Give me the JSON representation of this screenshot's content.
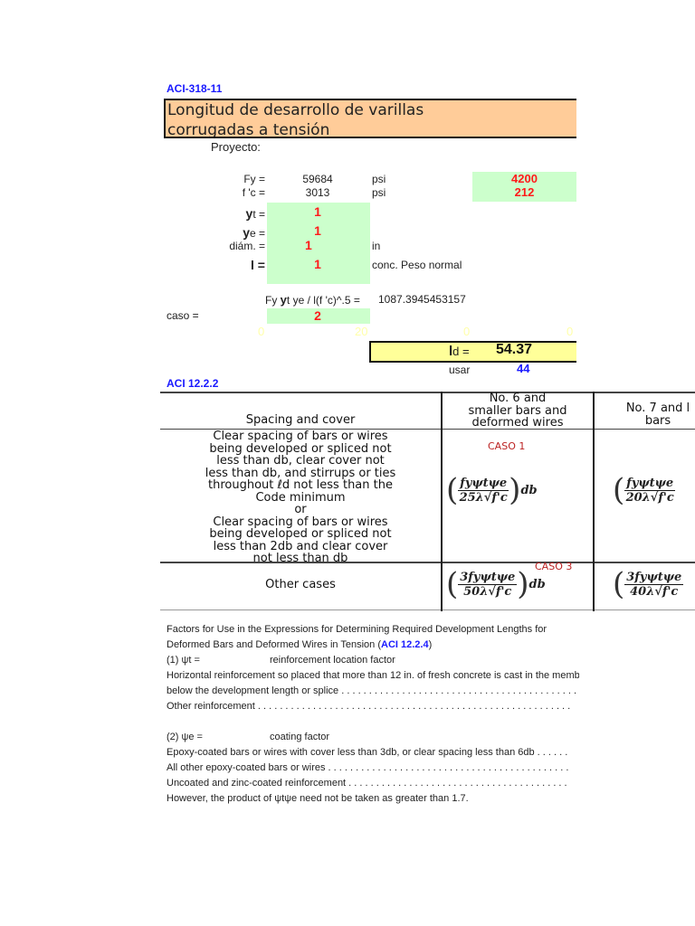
{
  "header": {
    "code": "ACI-318-11",
    "title_line1": "Longitud de desarrollo de varillas",
    "title_line2": "corrugadas a tensión",
    "project_label": "Proyecto:"
  },
  "inputs": {
    "fy": {
      "label": "Fy =",
      "value": "59684",
      "unit": "psi",
      "alt": "4200"
    },
    "fc": {
      "label": "f 'c =",
      "value": "3013",
      "unit": "psi",
      "alt": "212"
    },
    "psit": {
      "label_b": "y",
      "label": "t =",
      "value": "1"
    },
    "psie": {
      "label_b": "y",
      "label": "e =",
      "value": "1"
    },
    "diam": {
      "label": "diám.  =",
      "value": "1",
      "unit": "in"
    },
    "lambda": {
      "label": "l =",
      "value": "1",
      "unit": "conc. Peso normal"
    }
  },
  "calc": {
    "formula_a": "Fy ",
    "formula_b": "y",
    "formula_c": "t ye / l(f 'c)^.5 =",
    "formula_value": "1087.3945453157",
    "caso_label": "caso =",
    "caso_value": "2",
    "hidden": [
      "0",
      "20",
      "0",
      "0"
    ],
    "ld_label_b": "l",
    "ld_label": "d =",
    "ld_value": "54.37",
    "usar_label": "usar",
    "usar_value": "44"
  },
  "table": {
    "ref": "ACI 12.2.2",
    "headers": [
      "Spacing and cover",
      "No. 6 and\nsmaller bars and\ndeformed wires",
      "No. 7 and l\nbars"
    ],
    "row1_text": "Clear spacing of bars or wires\nbeing developed or spliced not\nless than db, clear cover not\nless than db, and stirrups or ties\nthroughout ℓd not less than the\nCode minimum\nor\nClear spacing of bars or wires\nbeing developed or spliced not\nless than 2db and clear cover\nnot less than db",
    "row2_text": "Other cases",
    "caso1": "CASO  1",
    "caso3": "CASO 3",
    "f1_num": "fyψtψe",
    "f1_den": "25λ√f'c",
    "f2_den": "20λ√f'c",
    "f3_num": "3fyψtψe",
    "f3_den": "50λ√f'c",
    "f4_den": "40λ√f'c",
    "db": "db"
  },
  "factors": {
    "intro1": "Factors for Use in the Expressions for Determining Required Development Lengths for",
    "intro2a": "Deformed Bars and Deformed Wires in Tension (",
    "intro2ref": "ACI 12.2.4",
    "intro2b": ")",
    "psit_label": "(1) ψt =",
    "psit_desc": "reinforcement location factor",
    "l1": "Horizontal reinforcement so placed that more than 12 in. of fresh concrete is cast in the member",
    "l2": "below the development length or splice . . . . . . . . . . . . . . . . . . . . . . . . . . . . . . . . . . . . . . . . . . .",
    "l3": "Other reinforcement . . . . . . . . . . . . . . . . . . . . . . . . . . . . . . . . . . . . . . . . . . . . . . . . . . . . . . . . .",
    "psie_label": "(2) ψe =",
    "psie_desc": "coating factor",
    "l4": "Epoxy-coated bars or wires with cover less than 3db, or clear spacing less than 6db . . . . . .",
    "l5": "All other epoxy-coated bars or wires . . . . . . . . . . . . . . . . . . . . . . . . . . . . . . . . . . . . . . . . . . . .",
    "l6": "Uncoated and zinc-coated reinforcement . . . . . . . . . . . . . . . . . . . . . . . . . . . . . . . . . . . . . . . .",
    "l7": "However, the product of ψtψe need not be taken as greater than 1.7."
  }
}
